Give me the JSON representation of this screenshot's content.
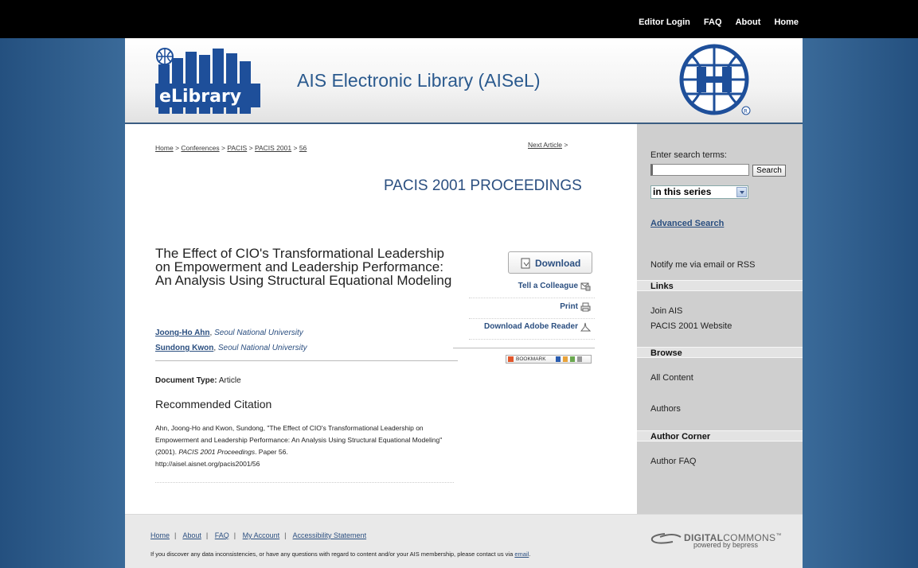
{
  "topnav": {
    "items": [
      "Editor Login",
      "FAQ",
      "About",
      "Home"
    ]
  },
  "header": {
    "title": "AIS Electronic Library (AISeL)",
    "logo_text": "eLibrary"
  },
  "breadcrumb": {
    "items": [
      "Home",
      "Conferences",
      "PACIS",
      "PACIS 2001",
      "56"
    ],
    "separator": ">"
  },
  "next_article": {
    "label": "Next Article",
    "arrow": ">"
  },
  "series_title": "PACIS 2001 PROCEEDINGS",
  "article": {
    "title": "The Effect of CIO's Transformational Leadership on Empowerment and Leadership Performance: An Analysis Using Structural Equational Modeling",
    "authors": [
      {
        "name": "Joong-Ho Ahn",
        "affiliation": "Seoul National University"
      },
      {
        "name": "Sundong Kwon",
        "affiliation": "Seoul National University"
      }
    ],
    "doc_type_label": "Document Type:",
    "doc_type": "Article",
    "citation_heading": "Recommended Citation",
    "citation_part1": "Ahn, Joong-Ho and Kwon, Sundong, \"The Effect of CIO's Transformational Leadership on Empowerment and Leadership Performance: An Analysis Using Structural Equational Modeling\" (2001).",
    "citation_proceedings": "PACIS 2001 Proceedings",
    "citation_part2": ". Paper 56.",
    "citation_url": "http://aisel.aisnet.org/pacis2001/56"
  },
  "actions": {
    "download": "Download",
    "tell_colleague": "Tell a Colleague",
    "print": "Print",
    "adobe": "Download Adobe Reader",
    "bookmark": "BOOKMARK"
  },
  "sidebar": {
    "search_label": "Enter search terms:",
    "search_value": "",
    "search_button": "Search",
    "scope_selected": "in this series",
    "advanced_search": "Advanced Search",
    "notify": "Notify me via email or RSS",
    "links_heading": "Links",
    "links": [
      "Join AIS",
      "PACIS 2001 Website"
    ],
    "browse_heading": "Browse",
    "browse": [
      "All Content",
      "Authors"
    ],
    "author_corner_heading": "Author Corner",
    "author_corner": [
      "Author FAQ"
    ]
  },
  "footer": {
    "links": [
      "Home",
      "About",
      "FAQ",
      "My Account",
      "Accessibility Statement"
    ],
    "note": "If you discover any data inconsistencies, or have any questions with regard to content and/or your AIS membership, please contact us via",
    "note_link": "email",
    "dc_brand_a": "DIGITAL",
    "dc_brand_b": "COMMONS",
    "dc_tm": "™",
    "dc_sub": "powered by bepress"
  },
  "colors": {
    "link": "#2b4f80",
    "topbar": "#000000",
    "background": "#3a6a99",
    "sidebar": "#cfcfcf"
  }
}
